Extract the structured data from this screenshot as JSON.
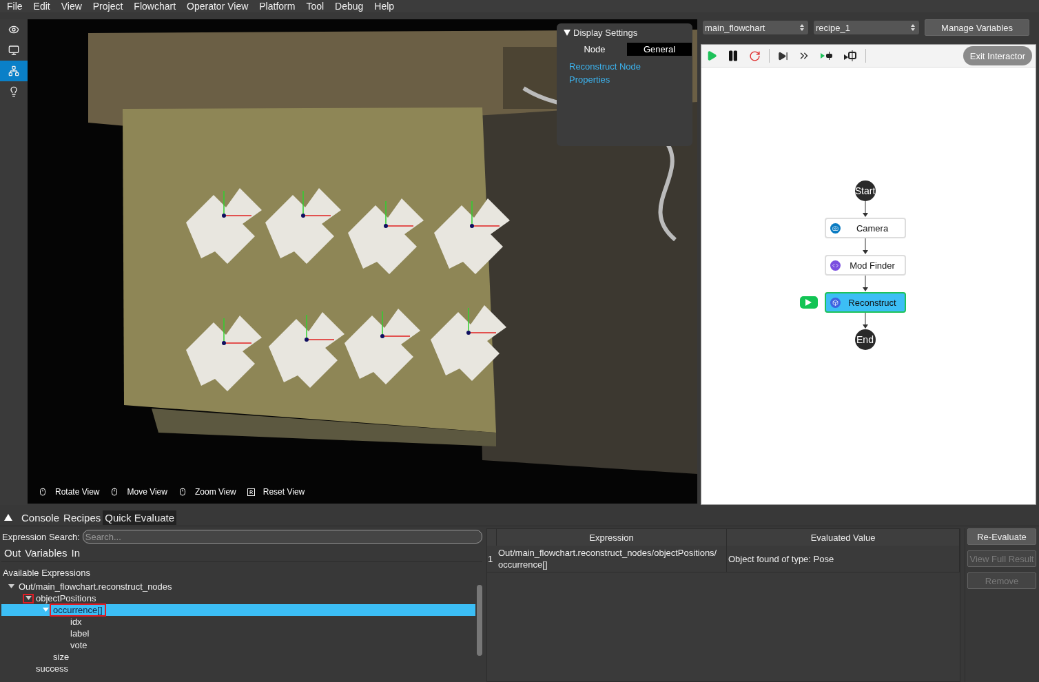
{
  "menu": [
    "File",
    "Edit",
    "View",
    "Project",
    "Flowchart",
    "Operator View",
    "Platform",
    "Tool",
    "Debug",
    "Help"
  ],
  "sidebar": [
    {
      "kind": "eye",
      "selected": false
    },
    {
      "kind": "monitor",
      "selected": false
    },
    {
      "kind": "flowchart",
      "selected": true
    },
    {
      "kind": "bulb",
      "selected": false
    }
  ],
  "viewer": {
    "display_settings": {
      "title": "Display Settings",
      "expanded": true,
      "tabs": [
        {
          "label": "Node",
          "selected": false
        },
        {
          "label": "General",
          "selected": true
        }
      ],
      "link": "Reconstruct Node Properties"
    },
    "hints": [
      {
        "kind": "mouse-left",
        "label": "Rotate View"
      },
      {
        "kind": "mouse-right",
        "label": "Move View"
      },
      {
        "kind": "mouse-wheel",
        "label": "Zoom View"
      },
      {
        "kind": "key-r",
        "label": "Reset View"
      }
    ]
  },
  "flowchart": {
    "selectors": [
      "main_flowchart",
      "recipe_1"
    ],
    "manage_button": "Manage Variables",
    "toolbar": [
      {
        "kind": "run"
      },
      {
        "kind": "pause"
      },
      {
        "kind": "restart"
      },
      {
        "kind": "step"
      },
      {
        "kind": "step-all"
      },
      {
        "kind": "run-to"
      },
      {
        "kind": "breakpoint"
      }
    ],
    "exit_button": "Exit Interactor",
    "nodes": [
      {
        "kind": "terminal",
        "label": "Start"
      },
      {
        "kind": "step",
        "label": "Camera",
        "color": "#0a7bc2",
        "selected": false,
        "running": false
      },
      {
        "kind": "step",
        "label": "Mod Finder",
        "color": "#7b4fe0",
        "selected": false,
        "running": false
      },
      {
        "kind": "step",
        "label": "Reconstruct",
        "color": "#3d63e0",
        "selected": true,
        "running": true
      },
      {
        "kind": "terminal",
        "label": "End"
      }
    ]
  },
  "bottom": {
    "tabs": [
      {
        "label": "Console",
        "selected": false
      },
      {
        "label": "Recipes",
        "selected": false
      },
      {
        "label": "Quick Evaluate",
        "selected": true
      }
    ],
    "search": {
      "label": "Expression Search:",
      "placeholder": "Search..."
    },
    "subtabs": [
      "Out",
      "Variables",
      "In"
    ],
    "tree_title": "Available Expressions",
    "tree": [
      {
        "label": "Out/main_flowchart.reconstruct_nodes",
        "expanded": true,
        "selected": false,
        "marked": false,
        "children": [
          {
            "label": "objectPositions",
            "expanded": true,
            "selected": false,
            "marked": true,
            "children": [
              {
                "label": "occurrence[]",
                "expanded": true,
                "selected": true,
                "marked": true,
                "children": [
                  {
                    "label": "idx",
                    "selected": false,
                    "marked": false
                  },
                  {
                    "label": "label",
                    "selected": false,
                    "marked": false
                  },
                  {
                    "label": "vote",
                    "selected": false,
                    "marked": false
                  }
                ]
              },
              {
                "label": "size",
                "selected": false,
                "marked": false
              }
            ]
          },
          {
            "label": "success",
            "selected": false,
            "marked": false
          }
        ]
      }
    ],
    "table": {
      "columns": [
        "Expression",
        "Evaluated Value"
      ],
      "rows": [
        {
          "index": "1",
          "expression": "Out/main_flowchart.reconstruct_nodes/objectPositions/ occurrence[]",
          "value": "Object found of type: Pose"
        }
      ]
    },
    "buttons": [
      {
        "label": "Re-Evaluate",
        "disabled": false
      },
      {
        "label": "View Full Result",
        "disabled": true
      },
      {
        "label": "Remove",
        "disabled": true
      }
    ]
  }
}
